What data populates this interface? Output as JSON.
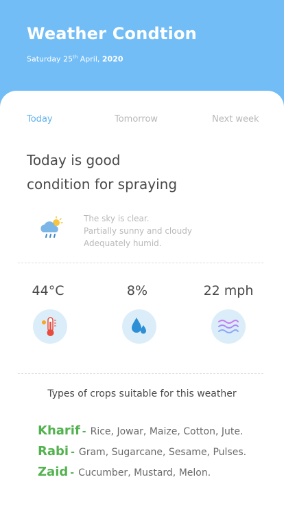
{
  "header": {
    "title": "Weather Condtion",
    "date_day": "Saturday 25",
    "date_suffix": "th",
    "date_month": " April, ",
    "date_year": "2020"
  },
  "tabs": [
    {
      "label": "Today",
      "active": true
    },
    {
      "label": "Tomorrow",
      "active": false
    },
    {
      "label": "Next week",
      "active": false
    }
  ],
  "headline": {
    "line1": "Today is good",
    "line2": "condition for spraying"
  },
  "sky": {
    "icon": "partly-cloudy-rain-icon",
    "lines": [
      "The sky is clear.",
      "Partially sunny and cloudy",
      "Adequately humid."
    ]
  },
  "stats": [
    {
      "value": "44°C",
      "icon": "thermometer-icon"
    },
    {
      "value": "8%",
      "icon": "water-drops-icon"
    },
    {
      "value": "22 mph",
      "icon": "wind-icon"
    }
  ],
  "crops": {
    "title": "Types of crops suitable for this weather",
    "items": [
      {
        "name": "Kharif",
        "list": "Rice, Jowar, Maize, Cotton, Jute."
      },
      {
        "name": "Rabi",
        "list": "Gram, Sugarcane, Sesame, Pulses."
      },
      {
        "name": "Zaid",
        "list": "Cucumber, Mustard, Melon."
      }
    ],
    "separator": "-"
  },
  "colors": {
    "header_bg": "#72bdf6",
    "active_tab": "#5fb0ef",
    "crop_name": "#53b24f",
    "icon_circle": "#dcedfa"
  }
}
